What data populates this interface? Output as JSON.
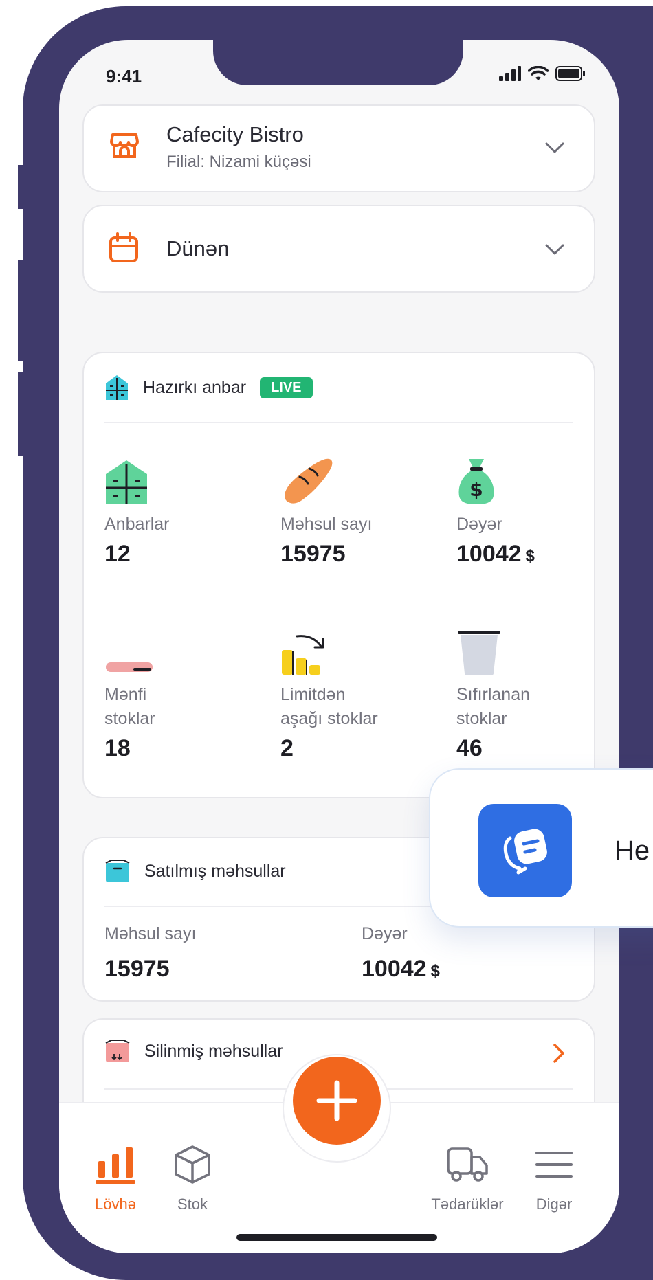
{
  "status_bar": {
    "time": "9:41"
  },
  "business": {
    "name": "Cafecity Bistro",
    "branch": "Filial: Nizami küçəsi"
  },
  "date_filter": {
    "label": "Dünən"
  },
  "current_stock": {
    "title": "Hazırkı anbar",
    "badge": "LIVE",
    "stats": [
      {
        "label": "Anbarlar",
        "value": "12",
        "unit": ""
      },
      {
        "label": "Məhsul sayı",
        "value": "15975",
        "unit": ""
      },
      {
        "label": "Dəyər",
        "value": "10042",
        "unit": "$"
      },
      {
        "label_line1": "Mənfi",
        "label_line2": "stoklar",
        "value": "18"
      },
      {
        "label_line1": "Limitdən",
        "label_line2": "aşağı stoklar",
        "value": "2"
      },
      {
        "label_line1": "Sıfırlanan",
        "label_line2": "stoklar",
        "value": "46"
      }
    ]
  },
  "popover": {
    "text": "He"
  },
  "sold_products": {
    "title": "Satılmış məhsullar",
    "count_label": "Məhsul sayı",
    "count_value": "15975",
    "value_label": "Dəyər",
    "value_value": "10042",
    "unit": "$"
  },
  "deleted_products": {
    "title": "Silinmiş məhsullar"
  },
  "tabbar": {
    "tabs": [
      {
        "label": "Lövhə",
        "icon": "bar-chart-icon",
        "active": true
      },
      {
        "label": "Stok",
        "icon": "box-icon"
      },
      {
        "label": "Tədarüklər",
        "icon": "truck-icon"
      },
      {
        "label": "Digər",
        "icon": "menu-icon"
      }
    ]
  },
  "colors": {
    "accent": "#f2661d",
    "frame": "#3f3a6b",
    "live": "#22b573",
    "popover_icon": "#2f6ee3"
  }
}
